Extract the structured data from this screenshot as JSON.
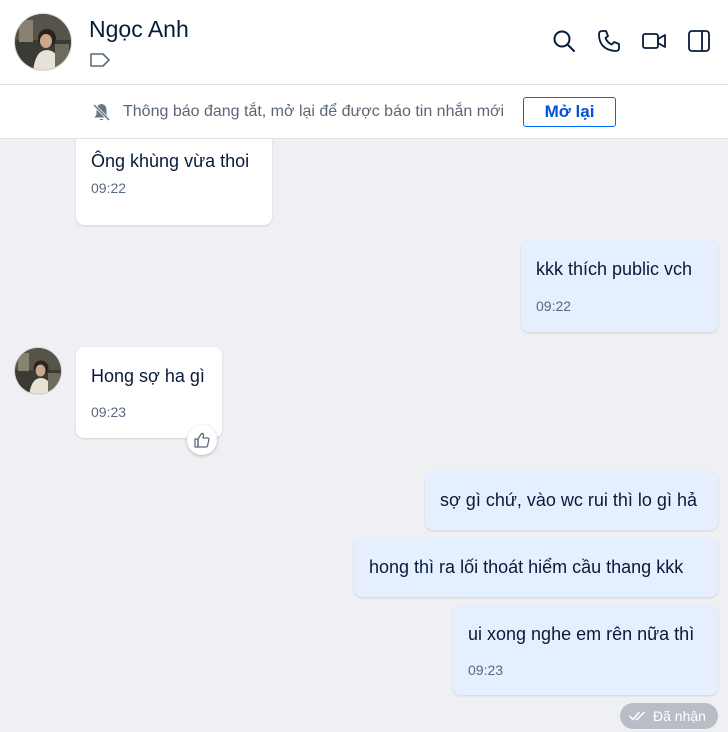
{
  "header": {
    "contact_name": "Ngọc Anh",
    "icons": [
      "tag-icon",
      "search-icon",
      "phone-icon",
      "video-call-icon",
      "sidebar-toggle-icon"
    ]
  },
  "banner": {
    "text": "Thông báo đang tắt, mở lại để được báo tin nhắn mới",
    "button_label": "Mở lại",
    "icon": "bell-off-icon"
  },
  "messages": [
    {
      "direction": "incoming",
      "text": "Ông khùng vừa thoi",
      "time": "09:22"
    },
    {
      "direction": "outgoing",
      "text": "kkk thích public vch",
      "time": "09:22"
    },
    {
      "direction": "incoming",
      "text": "Hong sợ ha gì",
      "time": "09:23",
      "reaction_icon": "thumbs-up-icon"
    },
    {
      "direction": "outgoing",
      "text": "sợ gì chứ, vào wc rui thì lo gì hả"
    },
    {
      "direction": "outgoing",
      "text": "hong thì ra lối thoát hiểm cầu thang kkk"
    },
    {
      "direction": "outgoing",
      "text": "ui xong nghe em rên nữa thì",
      "time": "09:23"
    }
  ],
  "status": {
    "text": "Đã nhận",
    "icon": "double-check-icon"
  },
  "colors": {
    "accent": "#0068ff",
    "chat_background": "#eef0f3",
    "incoming_bubble": "#ffffff",
    "outgoing_bubble": "#e5efff",
    "status_pill": "#b9bec6"
  }
}
